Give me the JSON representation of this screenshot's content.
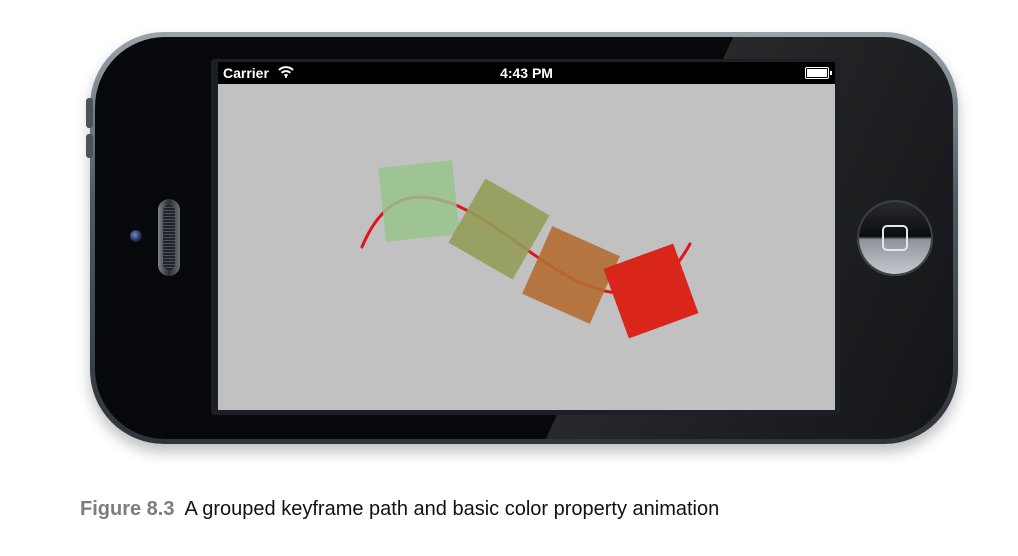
{
  "status_bar": {
    "carrier": "Carrier",
    "time": "4:43 PM",
    "wifi_icon": "wifi-icon",
    "battery_icon": "battery-icon",
    "battery_level": 1.0
  },
  "animation": {
    "path_color": "#e0141e",
    "frames": [
      {
        "color": "#97c48a",
        "opacity_label": "light green"
      },
      {
        "color": "#949c58",
        "opacity_label": "olive"
      },
      {
        "color": "#b26d33",
        "opacity_label": "orange-brown"
      },
      {
        "color": "#d9251a",
        "opacity_label": "red"
      }
    ]
  },
  "caption": {
    "label": "Figure 8.3",
    "text": "A grouped keyframe path and basic color property animation"
  },
  "colors": {
    "screen_background": "#c1c1c1",
    "device_body": "#07080b"
  }
}
